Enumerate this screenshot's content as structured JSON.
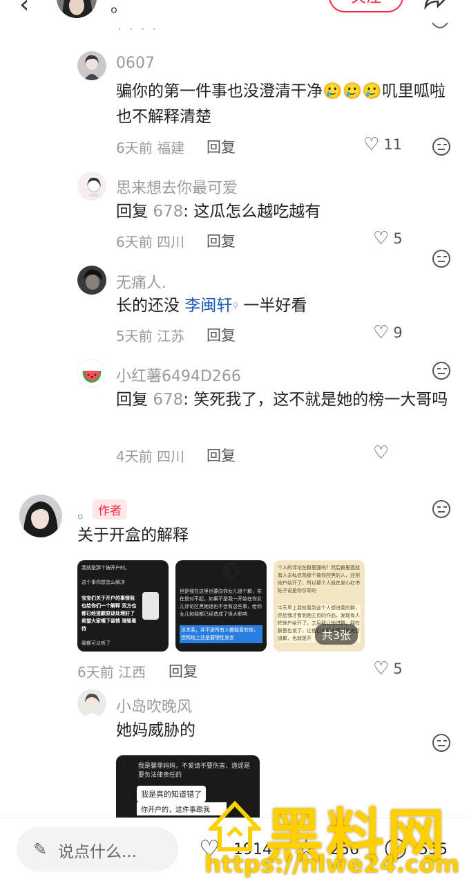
{
  "header": {
    "name": "。",
    "follow_label": "关注",
    "cut_text": "·  ·  ·  ·"
  },
  "comments": [
    {
      "username": "0607",
      "text": "骗你的第一件事也没澄清干净🥲🥲🥲叽里呱啦也不解释清楚",
      "time": "6天前",
      "location": "福建",
      "reply_label": "回复",
      "likes": "11"
    },
    {
      "username": "思来想去你最可爱",
      "reply_prefix": "回复 ",
      "reply_to": "678",
      "text": ": 这瓜怎么越吃越有",
      "time": "6天前",
      "location": "四川",
      "reply_label": "回复",
      "likes": "5"
    },
    {
      "username": "无痛人.",
      "text_before": "长的还没 ",
      "mention": "李闽轩",
      "text_after": " 一半好看",
      "time": "5天前",
      "location": "江苏",
      "reply_label": "回复",
      "likes": "9"
    },
    {
      "username": "小红薯6494D266",
      "reply_prefix": "回复 ",
      "reply_to": "678",
      "text": ": 笑死我了，这不就是她的榜一大哥吗",
      "time": "4天前",
      "location": "四川",
      "reply_label": "回复",
      "likes": ""
    },
    {
      "username": "。",
      "author_tag": "作者",
      "text": "关于开盒的解释",
      "image_count": "共3张",
      "time": "6天前",
      "location": "江西",
      "reply_label": "回复",
      "likes": "5",
      "images": [
        {
          "lines": [
            "我就是那个被开户的。",
            "这个事你想怎么解决",
            "宝宝们关于开户的事情我也给你们一个解释 双方也都已经道歉原谅处理好了 希望大家嘴下留情 理智看待",
            "我都可以听了"
          ]
        },
        {
          "lines": [
            "但是我在这里也要向你女儿道个歉，实在是对不起，如果不是我一开始在你女儿评论区黑她话也不会有这些事，给你女儿和我都已经造成了很大影响",
            "没关系，并不是所有人都能喜欢他，但网络上还是要理性发言"
          ]
        },
        {
          "lines": [
            "个人的评论在群里面吗？然后群里面就有人去私信骂那个被你控黑的人，还把他户给开了，所以那个人就在发小红书帖子说是你引导的",
            "今天早上我就看到这个人想进我的群，然后我才看到她主页的作品，发现有人把他户给开了，之后我让他进群，我在群里也说了，让他们也替大家对他进行道歉，也就是开"
          ]
        }
      ]
    },
    {
      "username": "小岛吹晚风",
      "text": "她妈威胁的",
      "image_lines": [
        "我是馨菲妈妈，不爱请不要伤害，造谣是要负法律责任的",
        "我是真的知道错了",
        "你开户的，这件事跟我"
      ]
    }
  ],
  "bottom": {
    "placeholder": "说点什么...",
    "likes": "1914",
    "stars": "256",
    "comments": "555"
  },
  "watermark": {
    "brand": "黑料网",
    "url": "https://hlwe24.com"
  }
}
